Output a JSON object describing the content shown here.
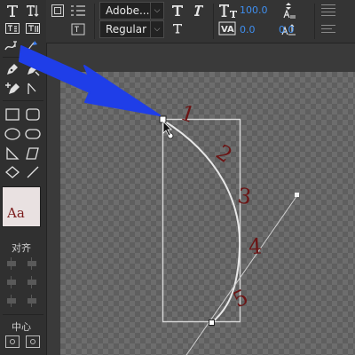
{
  "options_bar": {
    "font_family": "Adobe...",
    "font_style": "Regular",
    "tracking_value": "100.0",
    "kerning_value": "0.0",
    "baseline_value": "0.0",
    "icons": [
      "text-tool-icon",
      "paragraph-icon",
      "bold-icon",
      "italic-icon",
      "font-size-icon",
      "leading-icon",
      "underline-icon",
      "kerning-icon",
      "baseline-shift-icon",
      "align-justify-icon"
    ]
  },
  "tool_panel": {
    "style_swatch_text": "Aa",
    "align_label": "对齐",
    "center_label": "中心",
    "icons": [
      "type-tool-icon",
      "vertical-type-icon",
      "text-frame-icon",
      "vertical-text-frame-icon",
      "path-type-icon",
      "selection-tool-icon",
      "pen-tool-icon",
      "convert-anchor-icon",
      "add-anchor-icon",
      "direct-select-icon",
      "rectangle-icon",
      "rounded-rectangle-icon",
      "ellipse-icon",
      "rounded-ellipse-icon",
      "triangle-icon",
      "polygon-icon",
      "circle-icon",
      "line-icon"
    ]
  },
  "canvas": {
    "path_text": [
      "1",
      "2",
      "3",
      "4",
      "5"
    ],
    "text_color": "#6b1414",
    "annotation_arrow_color": "#1f3ee8"
  }
}
